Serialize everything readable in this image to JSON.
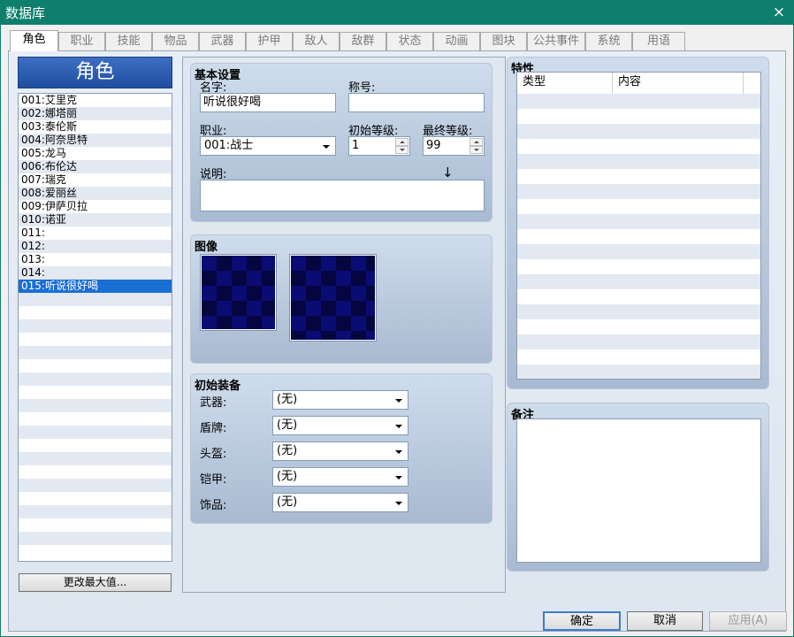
{
  "window": {
    "title": "数据库",
    "close_icon": "×"
  },
  "tabs": [
    "角色",
    "职业",
    "技能",
    "物品",
    "武器",
    "护甲",
    "敌人",
    "敌群",
    "状态",
    "动画",
    "图块",
    "公共事件",
    "系统",
    "用语"
  ],
  "left": {
    "header": "角色",
    "actors": [
      "001:艾里克",
      "002:娜塔丽",
      "003:泰伦斯",
      "004:阿奈思特",
      "005:龙马",
      "006:布伦达",
      "007:瑞克",
      "008:爱丽丝",
      "009:伊萨贝拉",
      "010:诺亚",
      "011:",
      "012:",
      "013:",
      "014:",
      "015:听说很好喝"
    ],
    "selected_index": 14,
    "max_button": "更改最大值..."
  },
  "basic": {
    "title": "基本设置",
    "name_label": "名字:",
    "name_value": "听说很好喝",
    "nickname_label": "称号:",
    "nickname_value": "",
    "class_label": "职业:",
    "class_value": "001:战士",
    "init_level_label": "初始等级:",
    "init_level_value": "1",
    "max_level_label": "最终等级:",
    "max_level_value": "99",
    "desc_label": "说明:",
    "desc_value": "",
    "cursor_glyph": "↓"
  },
  "images": {
    "title": "图像"
  },
  "equipment": {
    "title": "初始装备",
    "slots": [
      {
        "label": "武器:",
        "value": "(无)"
      },
      {
        "label": "盾牌:",
        "value": "(无)"
      },
      {
        "label": "头盔:",
        "value": "(无)"
      },
      {
        "label": "铠甲:",
        "value": "(无)"
      },
      {
        "label": "饰品:",
        "value": "(无)"
      }
    ]
  },
  "traits": {
    "title": "特性",
    "col_type": "类型",
    "col_content": "内容"
  },
  "notes": {
    "title": "备注",
    "value": ""
  },
  "buttons": {
    "ok": "确定",
    "cancel": "取消",
    "apply": "应用(A)"
  },
  "colors": {
    "titlebar": "#0e7f6c",
    "selection": "#1a6fd4",
    "header": "#2a5db0"
  }
}
